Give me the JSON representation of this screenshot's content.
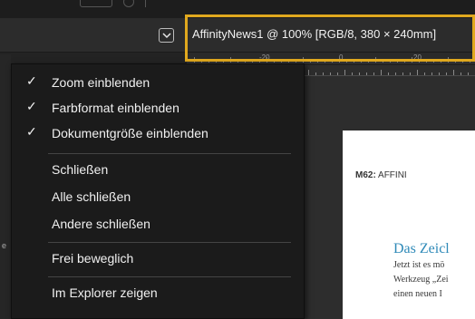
{
  "document": {
    "title": "AffinityNews1 @ 100% [RGB/8, 380 × 240mm]"
  },
  "ruler": {
    "labels": [
      "-20",
      "0",
      "20"
    ]
  },
  "menu": {
    "items": [
      {
        "label": "Zoom einblenden",
        "checked": true
      },
      {
        "label": "Farbformat einblenden",
        "checked": true
      },
      {
        "label": "Dokumentgröße einblenden",
        "checked": true
      },
      {
        "label": "Schließen",
        "checked": false
      },
      {
        "label": "Alle schließen",
        "checked": false
      },
      {
        "label": "Andere schließen",
        "checked": false
      },
      {
        "label": "Frei beweglich",
        "checked": false
      },
      {
        "label": "Im Explorer zeigen",
        "checked": false
      }
    ],
    "check_glyph": "✓"
  },
  "page": {
    "header_bold": "M62:",
    "header_rest": " AFFINI",
    "heading": "Das Zeicl",
    "lines": [
      "Jetzt ist es mö",
      "Werkzeug „Zei",
      "einen neuen I"
    ]
  },
  "colors": {
    "highlight": "#e0a81e",
    "heading": "#2f8ab8"
  },
  "icons": {
    "dropdown": "chevron-down-icon",
    "check": "checkmark-icon"
  }
}
